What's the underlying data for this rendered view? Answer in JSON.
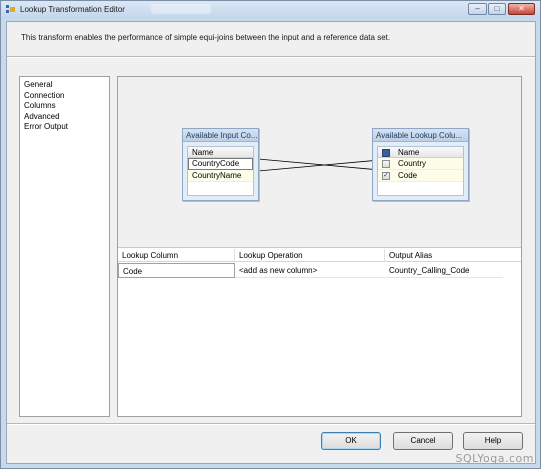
{
  "window": {
    "title": "Lookup Transformation Editor",
    "controls": [
      "–",
      "□",
      "✕"
    ]
  },
  "description": "This transform enables the performance of simple equi-joins between the input and a reference data set.",
  "nav": {
    "items": [
      "General",
      "Connection",
      "Columns",
      "Advanced",
      "Error Output"
    ]
  },
  "input_box": {
    "title": "Available Input Co...",
    "header": "Name",
    "columns": [
      "CountryCode",
      "CountryName"
    ]
  },
  "lookup_box": {
    "title": "Available Lookup Colu...",
    "header": "Name",
    "columns": [
      {
        "name": "Country",
        "checked": false,
        "mark": ""
      },
      {
        "name": "Code",
        "checked": true,
        "mark": "✓"
      }
    ]
  },
  "grid": {
    "headers": [
      "Lookup Column",
      "Lookup Operation",
      "Output Alias"
    ],
    "rows": [
      {
        "lookup_column": "Code",
        "operation": "<add as new column>",
        "alias": "Country_Calling_Code"
      }
    ]
  },
  "buttons": {
    "ok": "OK",
    "cancel": "Cancel",
    "help": "Help"
  },
  "watermark": "SQLYoga.com"
}
